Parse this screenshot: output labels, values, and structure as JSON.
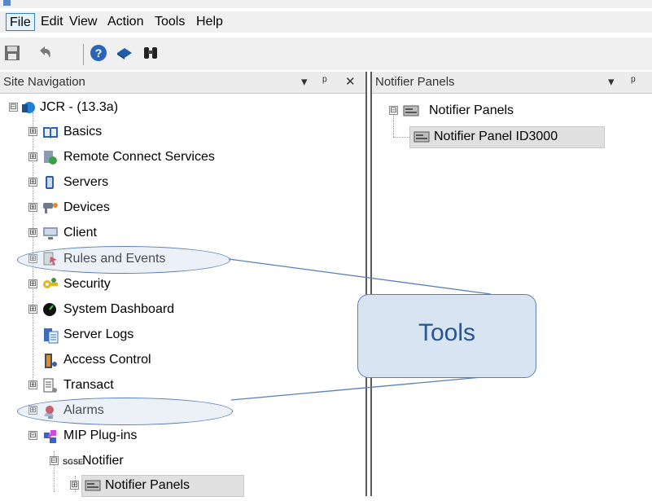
{
  "menu": [
    "File",
    "Edit",
    "View",
    "Action",
    "Tools",
    "Help"
  ],
  "toolbar": [
    {
      "name": "save-icon"
    },
    {
      "name": "undo-icon"
    },
    {
      "name": "help-icon"
    },
    {
      "name": "book-icon"
    },
    {
      "name": "binoculars-icon"
    }
  ],
  "site_navigation": {
    "title": "Site Navigation",
    "controls": [
      "▾",
      "ᵖ",
      "✕"
    ],
    "tree": [
      {
        "label": "JCR - (13.3a)",
        "icon": "server-globe-icon",
        "expander": "⊟"
      },
      {
        "label": "Basics",
        "icon": "book-icon",
        "expander": "⊞"
      },
      {
        "label": "Remote Connect Services",
        "icon": "remote-connect-icon",
        "expander": "⊞"
      },
      {
        "label": "Servers",
        "icon": "server-icon",
        "expander": "⊞"
      },
      {
        "label": "Devices",
        "icon": "camera-icon",
        "expander": "⊞"
      },
      {
        "label": "Client",
        "icon": "monitor-icon",
        "expander": "⊞"
      },
      {
        "label": "Rules and Events",
        "icon": "rules-icon",
        "expander": "⊞"
      },
      {
        "label": "Security",
        "icon": "keys-icon",
        "expander": "⊞"
      },
      {
        "label": "System Dashboard",
        "icon": "dashboard-icon",
        "expander": "⊞"
      },
      {
        "label": "Server Logs",
        "icon": "logs-icon",
        "expander": ""
      },
      {
        "label": "Access Control",
        "icon": "access-control-icon",
        "expander": ""
      },
      {
        "label": "Transact",
        "icon": "receipt-icon",
        "expander": "⊞"
      },
      {
        "label": "Alarms",
        "icon": "alarm-icon",
        "expander": "⊞"
      },
      {
        "label": "MIP Plug-ins",
        "icon": "puzzle-icon",
        "expander": "⊟"
      },
      {
        "label": "Notifier",
        "prefix": "SGSE",
        "icon": "sgse-icon",
        "expander": "⊟"
      },
      {
        "label": "Notifier Panels",
        "icon": "panel-icon",
        "expander": "⊞"
      }
    ]
  },
  "notifier_panels": {
    "title": "Notifier Panels",
    "controls": [
      "▾",
      "ᵖ"
    ],
    "tree": [
      {
        "label": "Notifier Panels",
        "icon": "panel-icon",
        "expander": "⊟"
      },
      {
        "label": "Notifier Panel ID3000",
        "icon": "panel-icon",
        "expander": ""
      }
    ]
  },
  "callout": {
    "text": "Tools"
  },
  "colors": {
    "callout_fill": "#d9e4f2",
    "callout_border": "#5b7fb8",
    "callout_text": "#25568f"
  }
}
